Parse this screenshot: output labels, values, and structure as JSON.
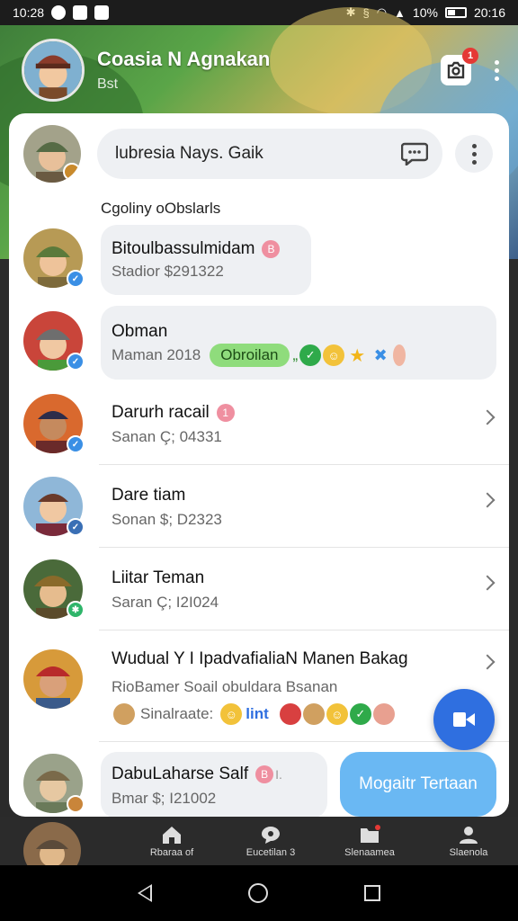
{
  "status_bar": {
    "time": "10:28",
    "battery": "10%",
    "clock_right": "20:16"
  },
  "header": {
    "title": "Coasia N Agnakan",
    "subtitle": "Bst",
    "camera_badge": "1"
  },
  "search": {
    "value": "lubresia Nays. Gaik"
  },
  "section_label": "Cgoliny oObslarls",
  "chats": [
    {
      "name": "Bitoulbassulmidam",
      "meta": "Stadior $291322",
      "badge": "B"
    },
    {
      "name": "Obman",
      "meta": "Maman 2018",
      "pill": "Obroilan",
      "trail": "„"
    },
    {
      "name": "Darurh racail",
      "meta": "Sanan Ç; 04331",
      "badge": "1"
    },
    {
      "name": "Dare tiam",
      "meta": "Sonan $; D2323"
    },
    {
      "name": "Liitar Teman",
      "meta": "Saran Ç; I2I024"
    },
    {
      "name": "Wudual Y I IpadvafialiaN Manen Bakag",
      "meta": "RioBamer Soail obuldara Bsanan",
      "meta2": "Sinalraate:",
      "meta2_extra": "lint"
    },
    {
      "name": "DabuLaharse Salf",
      "meta": "Bmar $; I21002",
      "badge": "B",
      "badge_suffix": "Ι."
    }
  ],
  "cta_label": "Mogaitr Tertaan",
  "bottom_nav": [
    {
      "label": "Rbaraa of",
      "icon": "home-icon"
    },
    {
      "label": "Eucetilan 3",
      "icon": "chat-bubble-icon"
    },
    {
      "label": "Slenaamea",
      "icon": "folder-icon"
    },
    {
      "label": "Slaenola",
      "icon": "person-icon"
    }
  ],
  "colors": {
    "accent_blue": "#2f6fe0",
    "cta_blue": "#6ab8f3",
    "green_pill": "#8fdc7c",
    "badge_red": "#e53935",
    "badge_pink": "#ef8fa0"
  }
}
